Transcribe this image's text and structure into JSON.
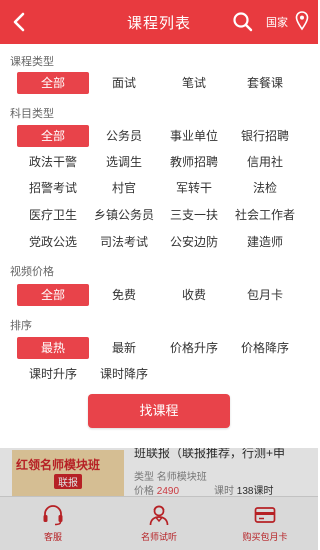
{
  "header": {
    "title": "课程列表",
    "region": "国家"
  },
  "filters": {
    "course_type": {
      "label": "课程类型",
      "options": [
        "全部",
        "面试",
        "笔试",
        "套餐课"
      ]
    },
    "subject_type": {
      "label": "科目类型",
      "options": [
        "全部",
        "公务员",
        "事业单位",
        "银行招聘",
        "政法干警",
        "选调生",
        "教师招聘",
        "信用社",
        "招警考试",
        "村官",
        "军转干",
        "法检",
        "医疗卫生",
        "乡镇公务员",
        "三支一扶",
        "社会工作者",
        "党政公选",
        "司法考试",
        "公安边防",
        "建造师"
      ]
    },
    "video_price": {
      "label": "视频价格",
      "options": [
        "全部",
        "免费",
        "收费",
        "包月卡"
      ]
    },
    "sort": {
      "label": "排序",
      "options": [
        "最热",
        "最新",
        "价格升序",
        "价格降序",
        "课时升序",
        "课时降序"
      ]
    }
  },
  "find_button": "找课程",
  "background_item": {
    "thumb_title": "红领名师模块班",
    "thumb_tag": "联报",
    "name": "班联报（联报推荐，行测+申",
    "type_label": "类型",
    "type_value": "名师模块班",
    "price_label": "价格",
    "price_value": "2490",
    "hours_label": "课时",
    "hours_value": "138课时"
  },
  "tabs": [
    "客服",
    "名师试听",
    "购买包月卡"
  ],
  "colors": {
    "accent": "#e8434a",
    "header": "#e83a3f"
  }
}
